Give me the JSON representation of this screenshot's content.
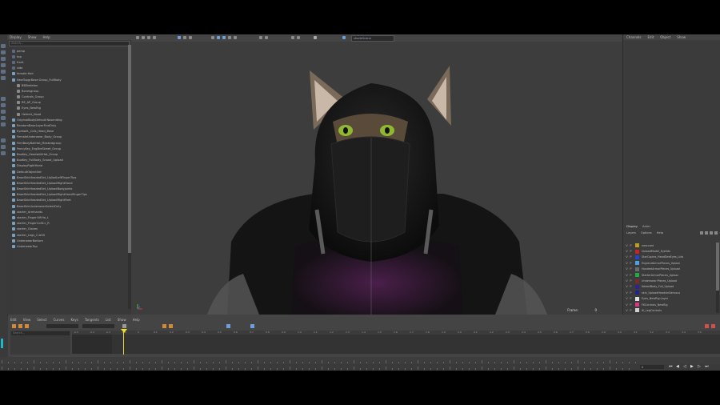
{
  "outliner": {
    "menu": [
      "Display",
      "Show",
      "Help"
    ],
    "search_placeholder": "Search...",
    "items": [
      {
        "label": "persp",
        "color": "#5a6a80"
      },
      {
        "label": "top",
        "color": "#5a6a80"
      },
      {
        "label": "front",
        "color": "#5a6a80"
      },
      {
        "label": "side",
        "color": "#5a6a80"
      },
      {
        "label": "female:Hair",
        "color": "#7aa0c0"
      },
      {
        "label": "NewTopgrBase:Group_FullBody",
        "color": "#7aa0c0"
      },
      {
        "label": "BBSkeleton",
        "color": "#8a8a8a"
      },
      {
        "label": "Bonesgroup",
        "color": "#8a8a8a"
      },
      {
        "label": "Controls_Group",
        "color": "#8a8a8a"
      },
      {
        "label": "RE_AP_Group",
        "color": "#8a8a8a"
      },
      {
        "label": "Eyes_NewRig",
        "color": "#8a8a8a"
      },
      {
        "label": "Helmet_Hood",
        "color": "#8a8a8a"
      },
      {
        "label": "OriginalBodyDefault:Nosending",
        "color": "#7aa0c0"
      },
      {
        "label": "RandomBaseLayerFindOnly",
        "color": "#7aa0c0"
      },
      {
        "label": "EyeballL_Cols_Head_Base",
        "color": "#7aa0c0"
      },
      {
        "label": "FemaleUnderwear_Body_Group",
        "color": "#7aa0c0"
      },
      {
        "label": "FemBodyBallHat_Maskedgroup",
        "color": "#7aa0c0"
      },
      {
        "label": "FancyKey_EngBreStreet_Group",
        "color": "#7aa0c0"
      },
      {
        "label": "BooKey_HeadwithHat_Group",
        "color": "#7aa0c0"
      },
      {
        "label": "BooKey_FullBody_Snood_Upload",
        "color": "#7aa0c0"
      },
      {
        "label": "DisplayRightHand",
        "color": "#7aa0c0"
      },
      {
        "label": "DefaultObjectSet",
        "color": "#7aa0c0"
      },
      {
        "label": "BaseSkinHeadedSet_UpliadLeftFingerTips",
        "color": "#7aa0c0"
      },
      {
        "label": "BaseSkinHeadedSet_UploadRightHand",
        "color": "#7aa0c0"
      },
      {
        "label": "BaseSkinHeadedSet_UploadBodyjoints",
        "color": "#7aa0c0"
      },
      {
        "label": "BaseSkinHeadedSet_UploadRightHandFingerTips",
        "color": "#7aa0c0"
      },
      {
        "label": "BaseSkinHeadedSet_UploadRightFeet",
        "color": "#7aa0c0"
      },
      {
        "label": "BaseSkinUnderwearSelectOnly",
        "color": "#7aa0c0"
      },
      {
        "label": "starter_Armhands",
        "color": "#7aa0c0"
      },
      {
        "label": "starter_Finger:Nf:Ha_L",
        "color": "#7aa0c0"
      },
      {
        "label": "starter_FingerCoSt:c_R",
        "color": "#7aa0c0"
      },
      {
        "label": "starter_Gloves",
        "color": "#7aa0c0"
      },
      {
        "label": "starter_Legs_C:AGS",
        "color": "#7aa0c0"
      },
      {
        "label": "UnderwearBottom",
        "color": "#7aa0c0"
      },
      {
        "label": "UnderwearTop",
        "color": "#7aa0c0"
      }
    ]
  },
  "viewport": {
    "camera_menu": "shadeScene",
    "frame_label": "Frame:",
    "frame_value": "0",
    "background": "#3d3d3d"
  },
  "channel_box": {
    "menu": [
      "Channels",
      "Edit",
      "Object",
      "Show"
    ]
  },
  "layer_editor": {
    "tabs": [
      "Display",
      "Anim"
    ],
    "menu": [
      "Layers",
      "Options",
      "Help"
    ],
    "layers": [
      {
        "label": "new:card",
        "color": "#b8a020"
      },
      {
        "label": "UploadModel_Eyelids",
        "color": "#cc2222"
      },
      {
        "label": "StarCopies_HeadDeeEyes_Lids",
        "color": "#2244cc"
      },
      {
        "label": "EnglandArmorPieces_Upload",
        "color": "#4aa0e0"
      },
      {
        "label": "HoodedArmorPieces_Upload",
        "color": "#6a6a6a"
      },
      {
        "label": "StarterArmorPieces_Upload",
        "color": "#22aa44"
      },
      {
        "label": "Underwear:Pieces_Upload",
        "color": "#7a2a2a"
      },
      {
        "label": "NakedBody_Full_Upload",
        "color": "#332288"
      },
      {
        "label": "skin_UploadHeadsInNervous",
        "color": "#222288"
      },
      {
        "label": "Eyes_NewRig:Layer",
        "color": "#e0e0e0"
      },
      {
        "label": "FKControls_NewRig",
        "color": "#dd3388"
      },
      {
        "label": "IK_LegControls",
        "color": "#cfcfcf"
      }
    ]
  },
  "graph_editor": {
    "menu": [
      "Edit",
      "View",
      "Select",
      "Curves",
      "Keys",
      "Tangents",
      "List",
      "Show",
      "Help"
    ],
    "search_placeholder": "Search...",
    "ruler_ticks": [
      "-0.5",
      "-0.4",
      "-0.3",
      "-0.2",
      "0",
      "0.1",
      "0.2",
      "0.3",
      "0.4",
      "0.5",
      "0.6",
      "0.7",
      "0.8",
      "0.9",
      "1.0",
      "1.1",
      "1.2",
      "1.3",
      "1.4",
      "1.5",
      "1.6",
      "1.7",
      "1.8",
      "1.9",
      "2.0",
      "2.1",
      "2.2",
      "2.3",
      "2.4",
      "2.5",
      "2.6",
      "2.7",
      "2.8",
      "2.9",
      "3.0",
      "3.1",
      "3.2",
      "3.3",
      "3.4",
      "3.5"
    ],
    "playhead_value": "0",
    "playhead_color": "#f0e020"
  },
  "time_controls": {
    "current_frame": "0"
  }
}
